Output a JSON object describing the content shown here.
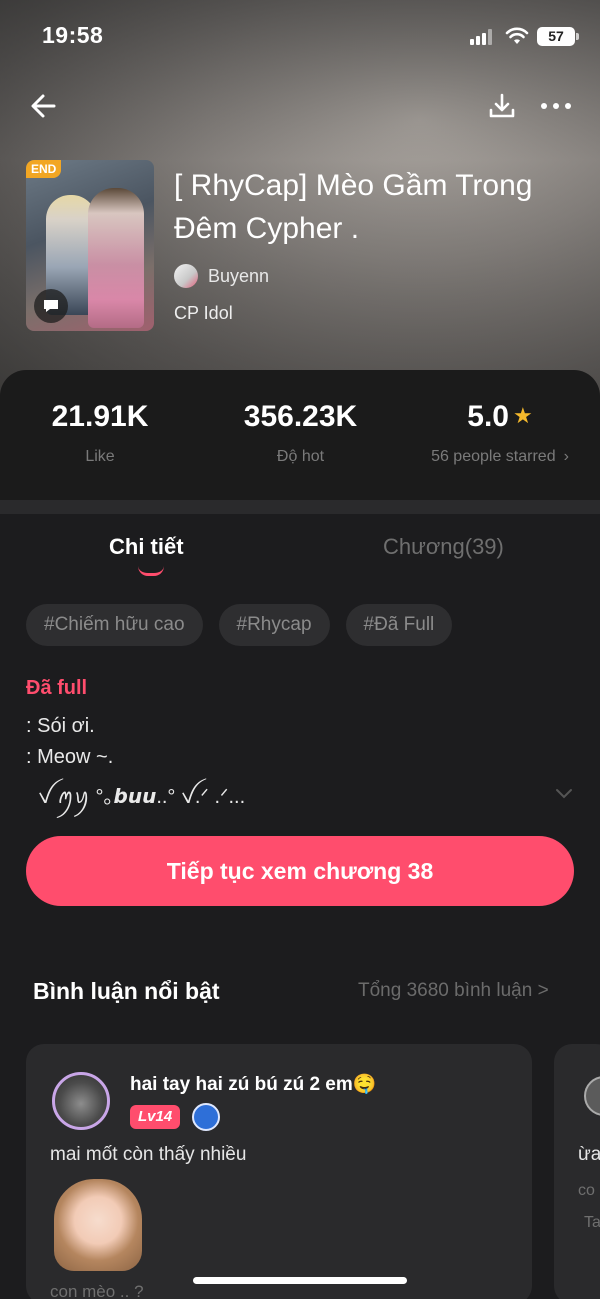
{
  "status": {
    "time": "19:58",
    "battery": "57"
  },
  "story": {
    "badge": "END",
    "title": "[ RhyCap] Mèo Gầm Trong Đêm Cypher .",
    "author": "Buyenn",
    "category": "CP Idol"
  },
  "stats": {
    "likes": "21.91K",
    "likes_label": "Like",
    "hot": "356.23K",
    "hot_label": "Độ hot",
    "rating": "5.0",
    "rating_label": "56 people starred"
  },
  "tabs": {
    "detail": "Chi tiết",
    "chapters": "Chương(39)"
  },
  "tags": [
    "#Chiếm hữu cao",
    "#Rhycap",
    "#Đã Full"
  ],
  "description": {
    "status": "Đã full",
    "line1": ": Sói ơi.",
    "line2": ": Meow ~.",
    "line3": "ꪜ ꪑꪗ °｡𝙗𝙪𝙪..° ꪜ.ᐟ .ᐟ..."
  },
  "continue_button": "Tiếp tục xem chương 38",
  "comments": {
    "title": "Bình luận nổi bật",
    "total": "Tổng 3680 bình luận >",
    "items": [
      {
        "user": "hai tay hai zú bú zú 2 em🤤",
        "level": "Lv14",
        "text": "mai mốt còn thấy nhiều",
        "reply": "con mèo .. ?"
      },
      {
        "text": "ừa",
        "sub1": "co",
        "sub2": "Ta"
      }
    ]
  },
  "colors": {
    "accent": "#ff4d6d",
    "star": "#f5b92c",
    "badge": "#f2a623"
  }
}
